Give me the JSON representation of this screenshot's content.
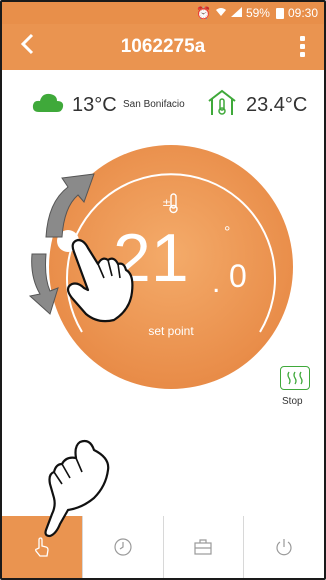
{
  "status_bar": {
    "battery": "59%",
    "time": "09:30"
  },
  "app_bar": {
    "title": "1062275a"
  },
  "weather": {
    "outdoor_temp": "13°C",
    "location": "San Bonifacio",
    "indoor_temp": "23.4°C"
  },
  "dial": {
    "setpoint_integer": "21",
    "setpoint_dot": ".",
    "setpoint_decimal": "0",
    "label": "set point",
    "indicator": "°"
  },
  "side_action": {
    "label": "Stop"
  },
  "bottom_nav": [
    {
      "icon": "hand-pointer-icon"
    },
    {
      "icon": "clock-icon"
    },
    {
      "icon": "toolbox-icon"
    },
    {
      "icon": "power-icon"
    }
  ],
  "colors": {
    "primary": "#ea9450",
    "dial_dark": "#e58a46",
    "dial_light": "#f3a866",
    "green": "#3fa93a",
    "arrow_gray": "#808080"
  }
}
